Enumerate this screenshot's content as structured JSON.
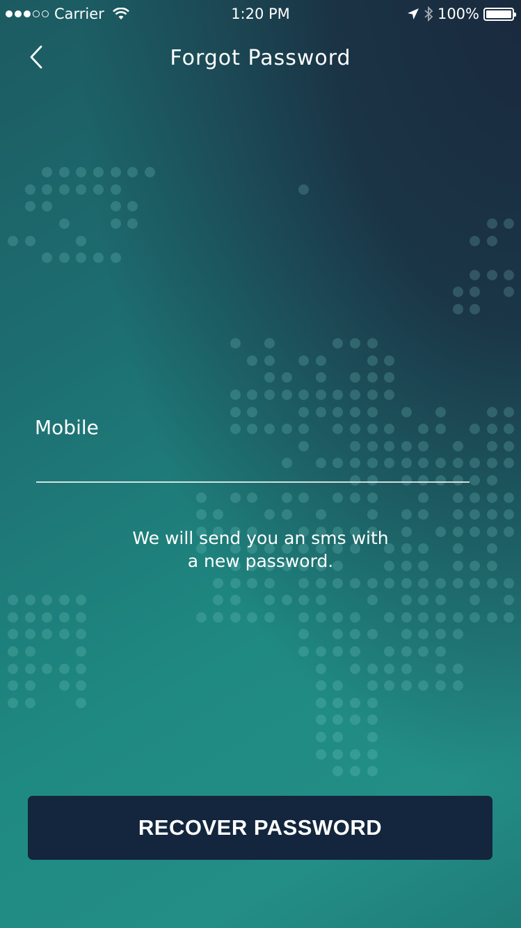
{
  "status_bar": {
    "carrier": "Carrier",
    "time": "1:20 PM",
    "battery": "100%",
    "signal_bars_filled": 3,
    "signal_bars_total": 5
  },
  "nav": {
    "title": "Forgot Password",
    "back_icon": "chevron-left-icon"
  },
  "form": {
    "mobile_label": "Mobile",
    "mobile_value": "",
    "helper_line1": "We will send you an sms with",
    "helper_line2": "a new password."
  },
  "actions": {
    "recover_label": "RECOVER PASSWORD"
  },
  "colors": {
    "button_bg": "#13263e",
    "bg_top_right": "#1a2a3e",
    "bg_bottom": "#238e86"
  }
}
